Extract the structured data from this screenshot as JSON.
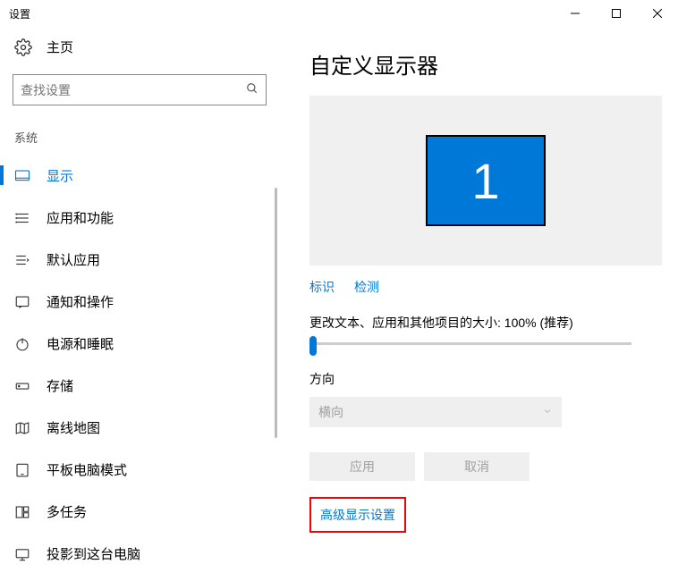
{
  "window": {
    "title": "设置"
  },
  "sidebar": {
    "home_label": "主页",
    "search_placeholder": "查找设置",
    "section_label": "系统",
    "items": [
      {
        "label": "显示"
      },
      {
        "label": "应用和功能"
      },
      {
        "label": "默认应用"
      },
      {
        "label": "通知和操作"
      },
      {
        "label": "电源和睡眠"
      },
      {
        "label": "存储"
      },
      {
        "label": "离线地图"
      },
      {
        "label": "平板电脑模式"
      },
      {
        "label": "多任务"
      },
      {
        "label": "投影到这台电脑"
      }
    ]
  },
  "content": {
    "title": "自定义显示器",
    "monitor_id": "1",
    "identify_link": "标识",
    "detect_link": "检测",
    "scale_label": "更改文本、应用和其他项目的大小: 100% (推荐)",
    "orientation_label": "方向",
    "orientation_value": "横向",
    "apply_btn": "应用",
    "cancel_btn": "取消",
    "advanced_link": "高级显示设置"
  }
}
